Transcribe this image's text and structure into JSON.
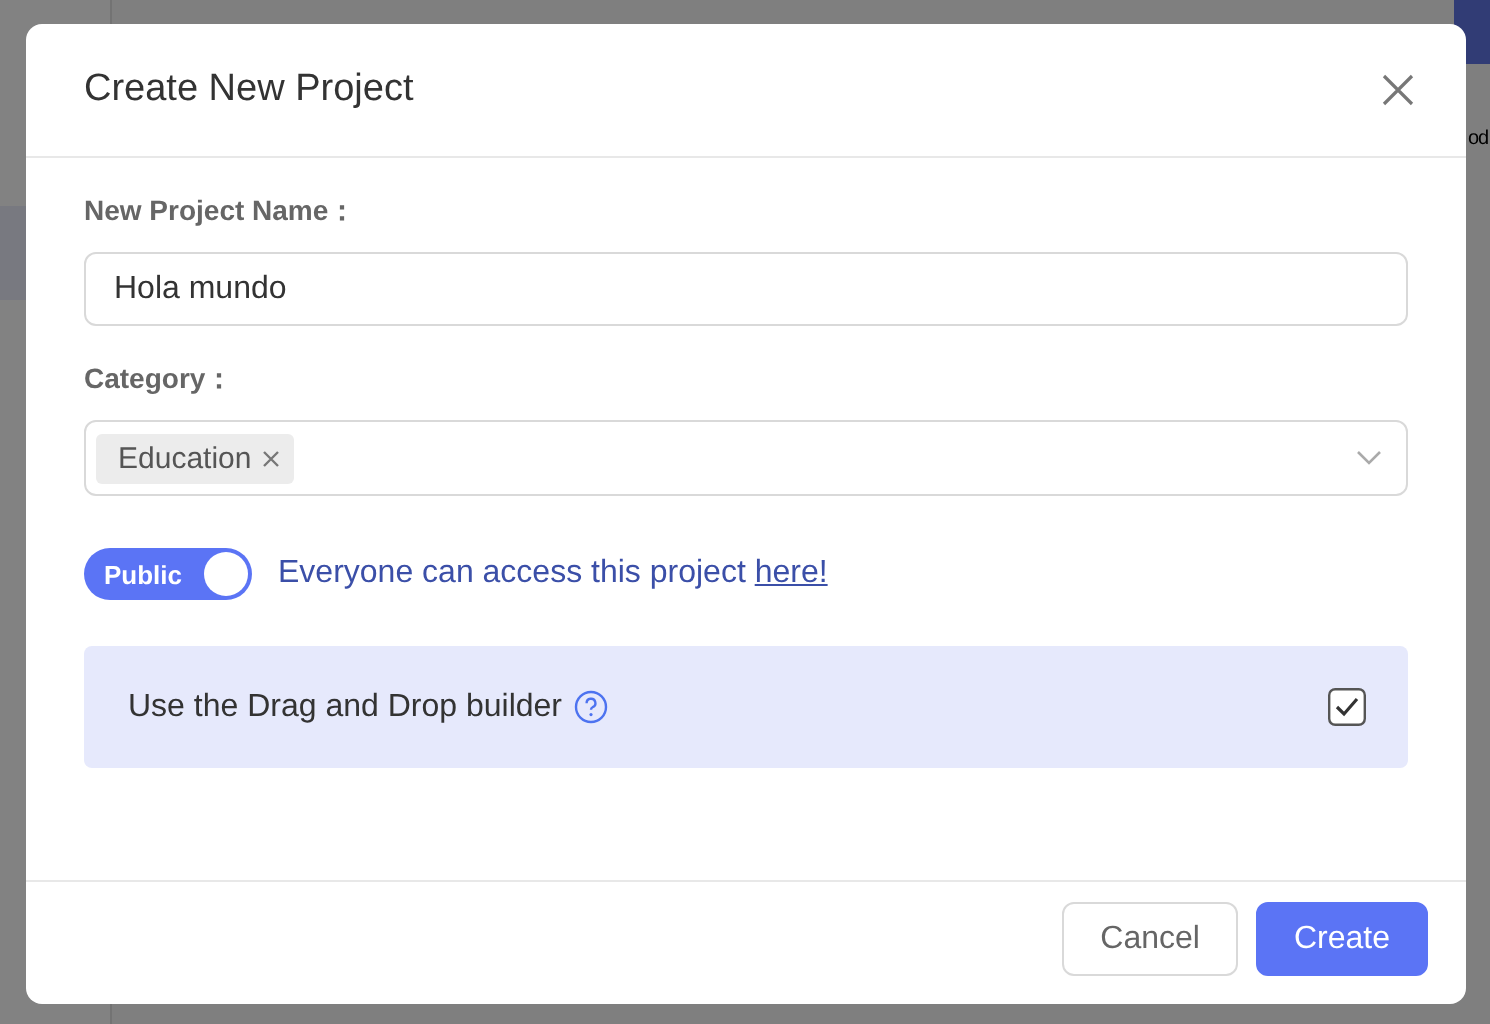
{
  "backdrop": {
    "texts": [
      {
        "text": "od"
      }
    ]
  },
  "dialog": {
    "title": "Create New Project",
    "fields": [
      {
        "kind": "text",
        "label": "New Project Name：",
        "value": "Hola mundo"
      },
      {
        "kind": "tags",
        "label": "Category：",
        "tags": [
          "Education"
        ]
      }
    ],
    "visibility": {
      "on": true,
      "label": "Public",
      "description": "Everyone can access this project ",
      "link": "here!"
    },
    "option": {
      "label": "Use the Drag and Drop builder",
      "checked": true
    },
    "buttons": [
      {
        "label": "Cancel",
        "kind": "secondary"
      },
      {
        "label": "Create",
        "kind": "primary"
      }
    ]
  }
}
